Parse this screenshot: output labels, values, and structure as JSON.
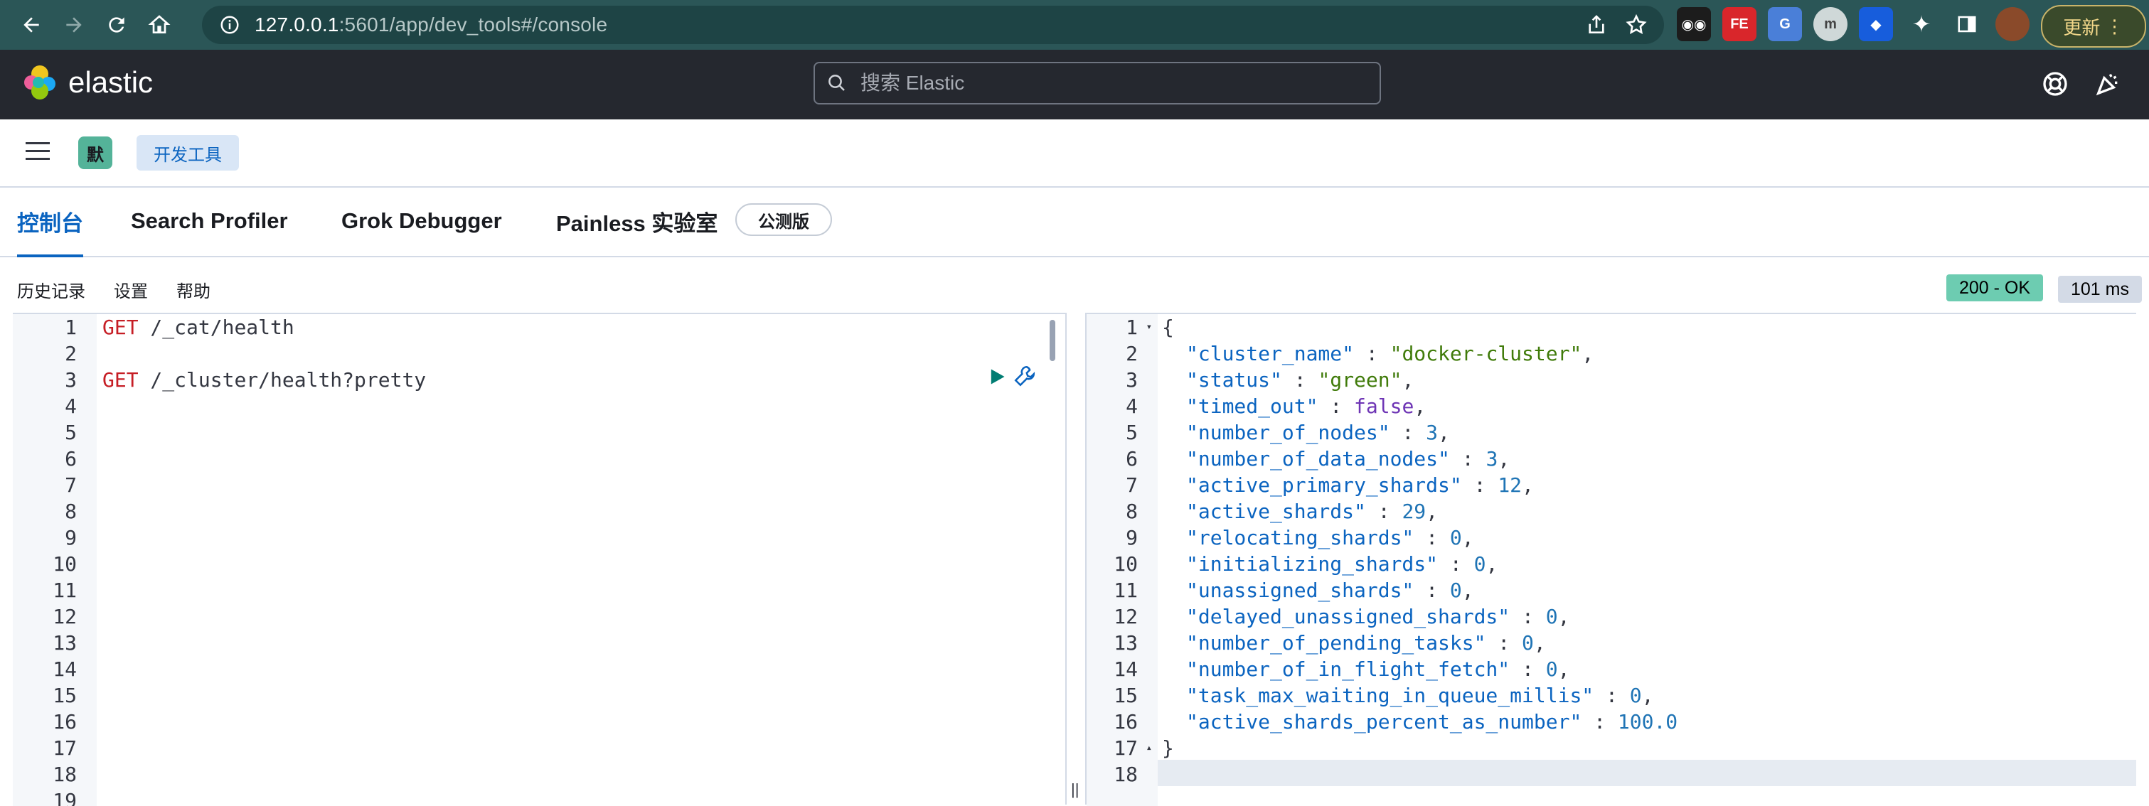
{
  "browser": {
    "url_host": "127.0.0.1",
    "url_path": ":5601/app/dev_tools#/console",
    "update_label": "更新"
  },
  "header": {
    "logo_text": "elastic",
    "search_placeholder": "搜索 Elastic"
  },
  "breadcrumb": {
    "space_initial": "默",
    "current": "开发工具"
  },
  "tabs": [
    {
      "label": "控制台",
      "active": true
    },
    {
      "label": "Search Profiler"
    },
    {
      "label": "Grok Debugger"
    },
    {
      "label": "Painless 实验室"
    }
  ],
  "beta_badge": "公测版",
  "toolbar": {
    "history": "历史记录",
    "settings": "设置",
    "help": "帮助",
    "status": "200 - OK",
    "duration": "101 ms"
  },
  "request_editor": {
    "line_numbers": [
      "1",
      "2",
      "3",
      "4",
      "5",
      "6",
      "7",
      "8",
      "9",
      "10",
      "11",
      "12",
      "13",
      "14",
      "15",
      "16",
      "17",
      "18",
      "19"
    ],
    "lines": [
      {
        "method": "GET",
        "path": " /_cat/health"
      },
      {
        "method": "",
        "path": ""
      },
      {
        "method": "GET",
        "path": " /_cluster/health?pretty"
      }
    ]
  },
  "response_editor": {
    "line_numbers": [
      "1",
      "2",
      "3",
      "4",
      "5",
      "6",
      "7",
      "8",
      "9",
      "10",
      "11",
      "12",
      "13",
      "14",
      "15",
      "16",
      "17",
      "18"
    ],
    "open_brace": "{",
    "close_brace": "}",
    "fields": [
      {
        "key": "\"cluster_name\"",
        "value": "\"docker-cluster\"",
        "type": "str",
        "comma": ","
      },
      {
        "key": "\"status\"",
        "value": "\"green\"",
        "type": "str",
        "comma": ","
      },
      {
        "key": "\"timed_out\"",
        "value": "false",
        "type": "bool",
        "comma": ","
      },
      {
        "key": "\"number_of_nodes\"",
        "value": "3",
        "type": "num",
        "comma": ","
      },
      {
        "key": "\"number_of_data_nodes\"",
        "value": "3",
        "type": "num",
        "comma": ","
      },
      {
        "key": "\"active_primary_shards\"",
        "value": "12",
        "type": "num",
        "comma": ","
      },
      {
        "key": "\"active_shards\"",
        "value": "29",
        "type": "num",
        "comma": ","
      },
      {
        "key": "\"relocating_shards\"",
        "value": "0",
        "type": "num",
        "comma": ","
      },
      {
        "key": "\"initializing_shards\"",
        "value": "0",
        "type": "num",
        "comma": ","
      },
      {
        "key": "\"unassigned_shards\"",
        "value": "0",
        "type": "num",
        "comma": ","
      },
      {
        "key": "\"delayed_unassigned_shards\"",
        "value": "0",
        "type": "num",
        "comma": ","
      },
      {
        "key": "\"number_of_pending_tasks\"",
        "value": "0",
        "type": "num",
        "comma": ","
      },
      {
        "key": "\"number_of_in_flight_fetch\"",
        "value": "0",
        "type": "num",
        "comma": ","
      },
      {
        "key": "\"task_max_waiting_in_queue_millis\"",
        "value": "0",
        "type": "num",
        "comma": ","
      },
      {
        "key": "\"active_shards_percent_as_number\"",
        "value": "100.0",
        "type": "num",
        "comma": ""
      }
    ]
  },
  "colors": {
    "accent": "#0b64c0",
    "status_ok": "#6dccb1",
    "header_bg": "#25282f",
    "chrome_bg": "#2b5657"
  }
}
